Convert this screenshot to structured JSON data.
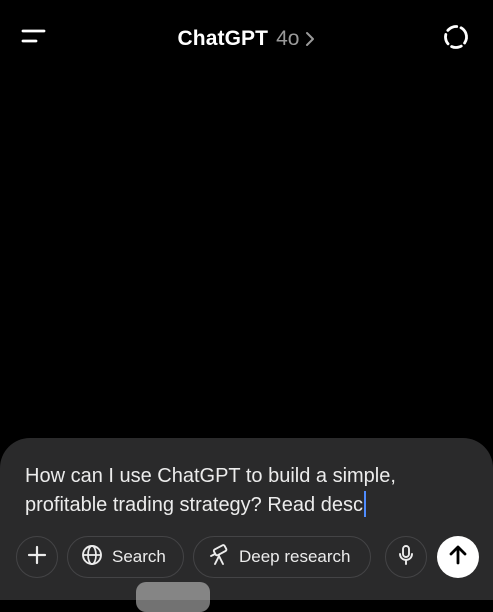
{
  "header": {
    "title": "ChatGPT",
    "model": "4o",
    "menu_icon": "menu-icon",
    "temporary_chat_icon": "dashed-circle-icon"
  },
  "composer": {
    "text": "How can I use ChatGPT to build a simple,\nprofitable trading strategy? Read desc",
    "toolbar": {
      "add_icon": "plus-icon",
      "search_label": "Search",
      "search_icon": "globe-icon",
      "deep_research_label": "Deep research",
      "deep_research_icon": "telescope-icon",
      "mic_icon": "microphone-icon",
      "send_icon": "arrow-up-icon"
    }
  },
  "colors": {
    "background": "#000000",
    "composer": "#2a2a2b",
    "caret": "#4f8cff",
    "muted_text": "#9a9a9a"
  }
}
